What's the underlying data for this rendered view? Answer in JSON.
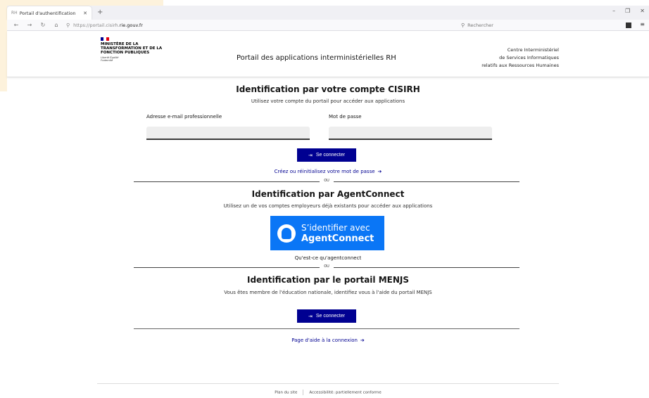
{
  "browser": {
    "tab_title": "Portail d'authentification",
    "tab_favicon": "RH",
    "url_prefix": "https://portail.cisirh.",
    "url_domain": "rie.gouv.fr",
    "search_placeholder": "Rechercher"
  },
  "header": {
    "ministry_name": "Ministère de la Transformation et de la Fonction Publiques",
    "motto": "Liberté Égalité Fraternité",
    "portal_title": "Portail des applications interministérielles RH",
    "centre_line1": "Centre Interministériel",
    "centre_line2": "de Services Informatiques",
    "centre_line3": "relatifs aux Ressources Humaines"
  },
  "cisirh": {
    "title": "Identification par votre compte CISIRH",
    "subtitle": "Utilisez votre compte du portail pour accéder aux applications",
    "email_label": "Adresse e-mail professionnelle",
    "email_value": "",
    "password_label": "Mot de passe",
    "password_value": "",
    "login_button": "Se connecter",
    "reset_link": "Créez ou réinitialisez votre mot de passe"
  },
  "separator": "OU",
  "agentconnect": {
    "title": "Identification par AgentConnect",
    "subtitle": "Utilisez un de vos comptes employeurs déjà existants pour accéder aux applications",
    "button_line1": "S’identifier avec",
    "button_line2": "AgentConnect",
    "info_link": "Qu'est-ce qu'agentconnect"
  },
  "menjs": {
    "title": "Identification par le portail MENJS",
    "subtitle": "Vous êtes membre de l'éducation nationale, identifiez vous à l'aide du portail MENJS",
    "login_button": "Se connecter"
  },
  "help_link": "Page d'aide à la connexion",
  "footer": {
    "sitemap": "Plan du site",
    "accessibility": "Accessibilité: partiellement conforme"
  },
  "colors": {
    "primary": "#000091",
    "agentconnect": "#0a76f6"
  }
}
